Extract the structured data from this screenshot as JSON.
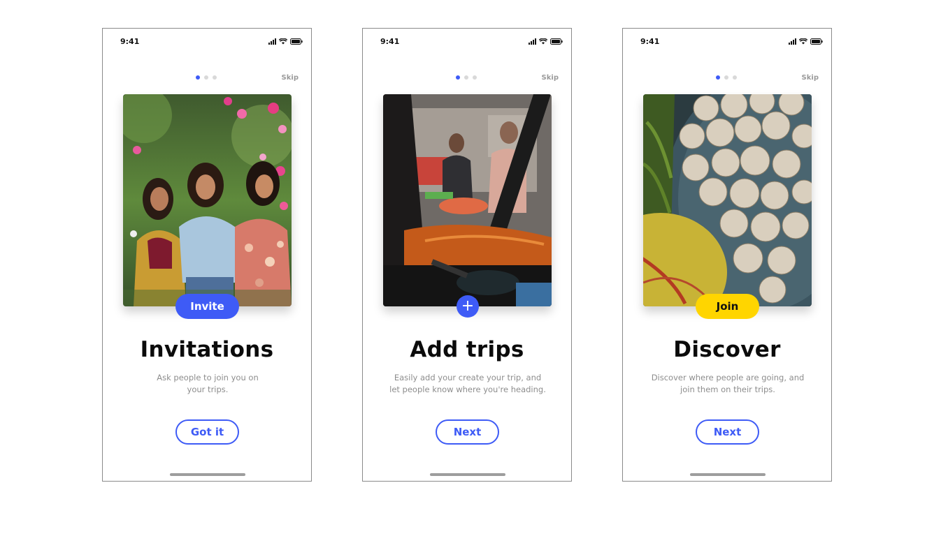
{
  "colors": {
    "accent": "#3e5bf6",
    "join": "#ffd500"
  },
  "screens": [
    {
      "status_time": "9:41",
      "skip_label": "Skip",
      "photo": "friends-garden-photo",
      "badge_label": "Invite",
      "title": "Invitations",
      "desc_line1": "Ask people to join you on",
      "desc_line2": "your trips.",
      "button_label": "Got it"
    },
    {
      "status_time": "9:41",
      "skip_label": "Skip",
      "photo": "auto-rickshaw-market-photo",
      "badge_icon": "plus-icon",
      "plus_glyph": "+",
      "title": "Add trips",
      "desc_line1": "Easily add your create your trip, and",
      "desc_line2": "let people know where you're heading.",
      "button_label": "Next"
    },
    {
      "status_time": "9:41",
      "skip_label": "Skip",
      "photo": "street-food-photo",
      "badge_label": "Join",
      "title": "Discover",
      "desc_line1": "Discover where people are going, and",
      "desc_line2": "join them on their trips.",
      "button_label": "Next"
    }
  ]
}
